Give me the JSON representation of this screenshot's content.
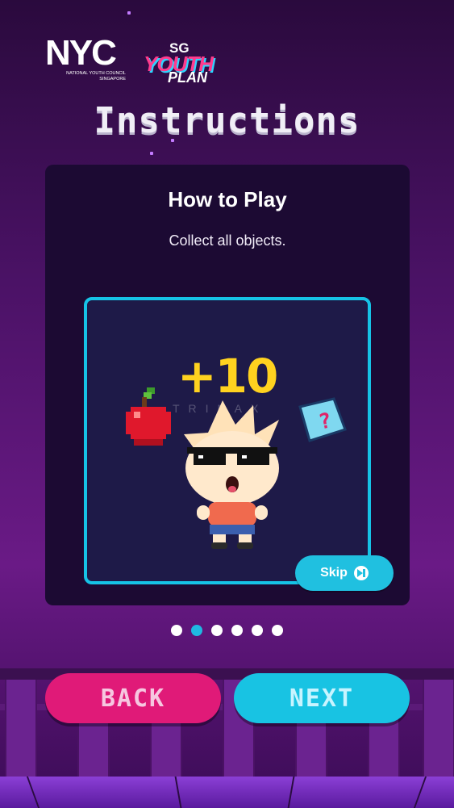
{
  "branding": {
    "nyc_wordmark": "NYC",
    "nyc_subtitle": "NATIONAL YOUTH COUNCIL SINGAPORE",
    "sg_top": "SG",
    "sg_youth": "YOUTH",
    "sg_plan": "PLAN"
  },
  "page": {
    "title": "Instructions"
  },
  "card": {
    "title": "How to Play",
    "text": "Collect all objects.",
    "score_text": "+10",
    "watermark": "TRINAX"
  },
  "skip": {
    "label": "Skip"
  },
  "pager": {
    "total": 6,
    "active_index": 1
  },
  "nav": {
    "back_label": "BACK",
    "next_label": "NEXT"
  },
  "colors": {
    "accent_cyan": "#18c3e3",
    "accent_pink": "#e01a78",
    "score_yellow": "#ffd21f",
    "card_bg": "#1c0a33"
  },
  "icons": [
    "apple-icon",
    "question-block-icon",
    "mascot-icon",
    "skip-icon"
  ]
}
